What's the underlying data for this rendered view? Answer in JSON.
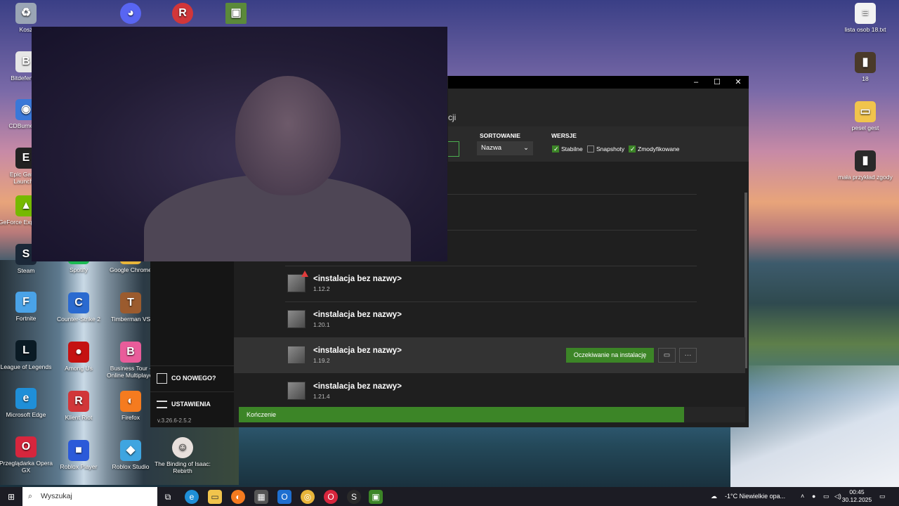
{
  "desktop": {
    "icons_left": [
      {
        "label": "Kosz",
        "glyph": "recycle-bin-icon",
        "char": "♻",
        "color": "#9aa5b5"
      },
      {
        "label": "Bitdefender",
        "glyph": "bitdefender-icon",
        "char": "B",
        "color": "#e6e6e6"
      },
      {
        "label": "CDBurnerXP",
        "glyph": "cdburner-icon",
        "char": "◉",
        "color": "#3a78d8"
      },
      {
        "label": "Epic Games Launcher",
        "glyph": "epic-icon",
        "char": "E",
        "color": "#222"
      },
      {
        "label": "GeForce Experience",
        "glyph": "geforce-icon",
        "char": "▲",
        "color": "#76b900"
      },
      {
        "label": "Steam",
        "glyph": "steam-icon",
        "char": "S",
        "color": "#1b2838"
      },
      {
        "label": "Fortnite",
        "glyph": "fortnite-icon",
        "char": "F",
        "color": "#4aa3e8"
      },
      {
        "label": "League of Legends",
        "glyph": "lol-icon",
        "char": "L",
        "color": "#0a1a24"
      },
      {
        "label": "Microsoft Edge",
        "glyph": "edge-icon",
        "char": "e",
        "color": "#1f8fd8"
      },
      {
        "label": "Przeglądarka Opera GX",
        "glyph": "operagx-icon",
        "char": "O",
        "color": "#d7263d"
      }
    ],
    "icons_col2": [
      {
        "label": "Spotify",
        "glyph": "spotify-icon",
        "char": "♫",
        "color": "#1db954"
      },
      {
        "label": "Counter-Strike 2",
        "glyph": "cs2-icon",
        "char": "C",
        "color": "#2a6ad0"
      },
      {
        "label": "Among Us",
        "glyph": "amongus-icon",
        "char": "●",
        "color": "#c51111"
      },
      {
        "label": "Klient Riot",
        "glyph": "riot-icon",
        "char": "R",
        "color": "#d13639"
      },
      {
        "label": "Roblox Player",
        "glyph": "roblox-icon",
        "char": "■",
        "color": "#2b5ad9"
      }
    ],
    "icons_col3": [
      {
        "label": "Google Chrome",
        "glyph": "chrome-icon",
        "char": "◎",
        "color": "#e8b53a"
      },
      {
        "label": "Timberman VS",
        "glyph": "timberman-icon",
        "char": "T",
        "color": "#9b5b2e"
      },
      {
        "label": "Business Tour - Online Multiplayer",
        "glyph": "businesstour-icon",
        "char": "B",
        "color": "#e95c9a"
      },
      {
        "label": "Firefox",
        "glyph": "firefox-icon",
        "char": "◐",
        "color": "#f57b1f"
      },
      {
        "label": "Roblox Studio",
        "glyph": "robloxstudio-icon",
        "char": "◆",
        "color": "#3fa5e0"
      }
    ],
    "icon_col4_label": "The Binding of Isaac: Rebirth",
    "icons_right": [
      {
        "label": "lista osob 18.txt",
        "glyph": "text-file-icon",
        "char": "≡",
        "color": "#f2f2f2"
      },
      {
        "label": "18",
        "glyph": "book-icon",
        "char": "▮",
        "color": "#4a3a2a"
      },
      {
        "label": "pesel gest",
        "glyph": "folder-icon",
        "char": "▭",
        "color": "#f1c44c"
      },
      {
        "label": "mała przykład zgody",
        "glyph": "document-icon",
        "char": "▮",
        "color": "#2a2a2a"
      }
    ]
  },
  "launcher": {
    "tab_partial": "cji",
    "sorting_label": "SORTOWANIE",
    "sorting_value": "Nazwa",
    "versions_label": "WERSJE",
    "filters": [
      {
        "label": "Stabilne",
        "checked": true
      },
      {
        "label": "Snapshoty",
        "checked": false
      },
      {
        "label": "Zmodyfikowane",
        "checked": true
      }
    ],
    "sidebar": {
      "whats_new": "CO NOWEGO?",
      "settings": "USTAWIENIA",
      "version": "v.3.26.6-2.5.2"
    },
    "installations": [
      {
        "name": "<instalacja bez nazwy>",
        "version": "1.12.2",
        "warning": true
      },
      {
        "name": "<instalacja bez nazwy>",
        "version": "1.20.1",
        "warning": false
      },
      {
        "name": "<instalacja bez nazwy>",
        "version": "1.19.2",
        "warning": false,
        "action": "Oczekiwanie na instalację",
        "more": "···"
      },
      {
        "name": "<instalacja bez nazwy>",
        "version": "1.21.4",
        "warning": false
      }
    ],
    "progress_label": "Kończenie",
    "progress_fraction": 0.88
  },
  "taskbar": {
    "search_placeholder": "Wyszukaj",
    "weather": "-1°C  Niewielkie opa...",
    "time": "00:45",
    "date": "30.12.2025"
  }
}
